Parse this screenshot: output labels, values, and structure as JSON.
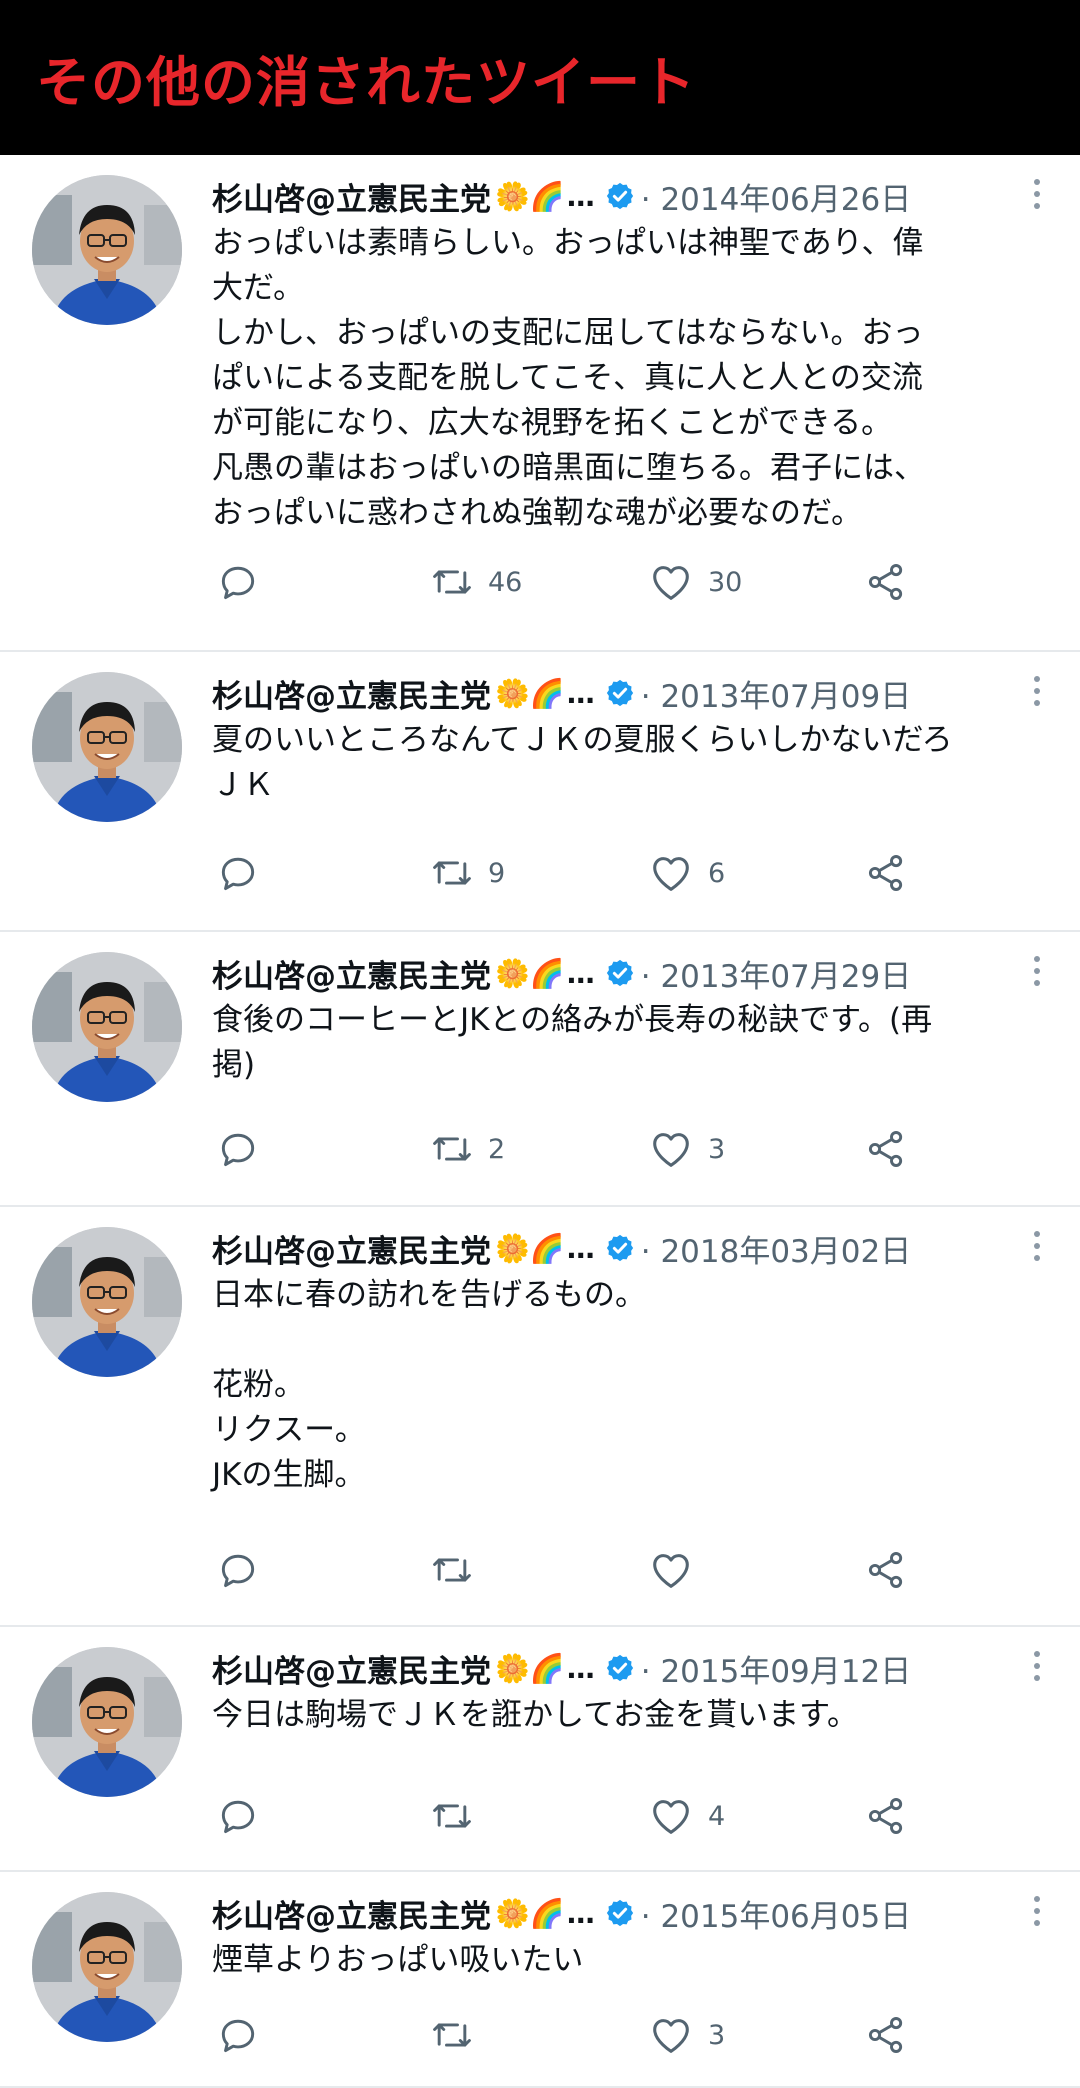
{
  "banner": {
    "title": "その他の消されたツイート"
  },
  "author": {
    "name": "杉山啓@立憲民主党",
    "emoji": "🌼🌈",
    "ellipsis": "…"
  },
  "colors": {
    "banner_bg": "#000000",
    "banner_text": "#e8262b",
    "verified": "#1d9bf0",
    "muted": "#536471"
  },
  "tweets": [
    {
      "date": "· 2014年06月26日",
      "lines": [
        "おっぱいは素晴らしい。おっぱいは神聖であり、偉",
        "大だ。",
        "しかし、おっぱいの支配に屈してはならない。おっ",
        "ぱいによる支配を脱してこそ、真に人と人との交流",
        "が可能になり、広大な視野を拓くことができる。",
        "凡愚の輩はおっぱいの暗黒面に堕ちる。君子には、",
        "おっぱいに惑わされぬ強靭な魂が必要なのだ。"
      ],
      "retweets": "46",
      "likes": "30"
    },
    {
      "date": "· 2013年07月09日",
      "lines": [
        "夏のいいところなんてＪＫの夏服くらいしかないだろ",
        "ＪＫ"
      ],
      "retweets": "9",
      "likes": "6"
    },
    {
      "date": "· 2013年07月29日",
      "lines": [
        "食後のコーヒーとJKとの絡みが長寿の秘訣です。(再",
        "掲)"
      ],
      "retweets": "2",
      "likes": "3"
    },
    {
      "date": "· 2018年03月02日",
      "lines": [
        "日本に春の訪れを告げるもの。",
        "",
        "花粉。",
        "リクスー。",
        "JKの生脚。"
      ],
      "retweets": "",
      "likes": ""
    },
    {
      "date": "· 2015年09月12日",
      "lines": [
        "今日は駒場でＪＫを誑かしてお金を貰います。"
      ],
      "retweets": "",
      "likes": "4"
    },
    {
      "date": "· 2015年06月05日",
      "lines": [
        "煙草よりおっぱい吸いたい"
      ],
      "retweets": "",
      "likes": "3"
    }
  ]
}
